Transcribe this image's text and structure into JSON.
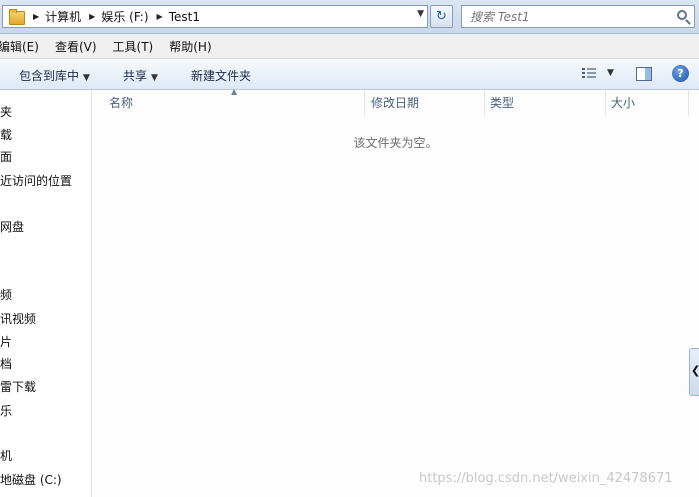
{
  "address_bar": {
    "crumbs": [
      "计算机",
      "娱乐 (F:)",
      "Test1"
    ],
    "refresh_glyph": "↻"
  },
  "search": {
    "placeholder": "搜索 Test1"
  },
  "menubar": {
    "items": [
      "编辑(E)",
      "查看(V)",
      "工具(T)",
      "帮助(H)"
    ]
  },
  "commandbar": {
    "include_in_library": "包含到库中",
    "share": "共享",
    "new_folder": "新建文件夹",
    "help_glyph": "?"
  },
  "nav_pane": {
    "items": [
      "夹",
      "载",
      "面",
      "近访问的位置",
      "网盘",
      "频",
      "讯视频",
      "片",
      "档",
      "雷下载",
      "乐",
      "机",
      "地磁盘 (C:)"
    ]
  },
  "columns": [
    "名称",
    "修改日期",
    "类型",
    "大小"
  ],
  "empty_message": "该文件夹为空。",
  "watermark": "https://blog.csdn.net/weixin_42478671",
  "icons": [
    "folder-icon",
    "chevron-right-icon",
    "refresh-icon",
    "search-icon",
    "view-options-icon",
    "preview-pane-icon",
    "help-icon",
    "collapse-pane-icon"
  ]
}
